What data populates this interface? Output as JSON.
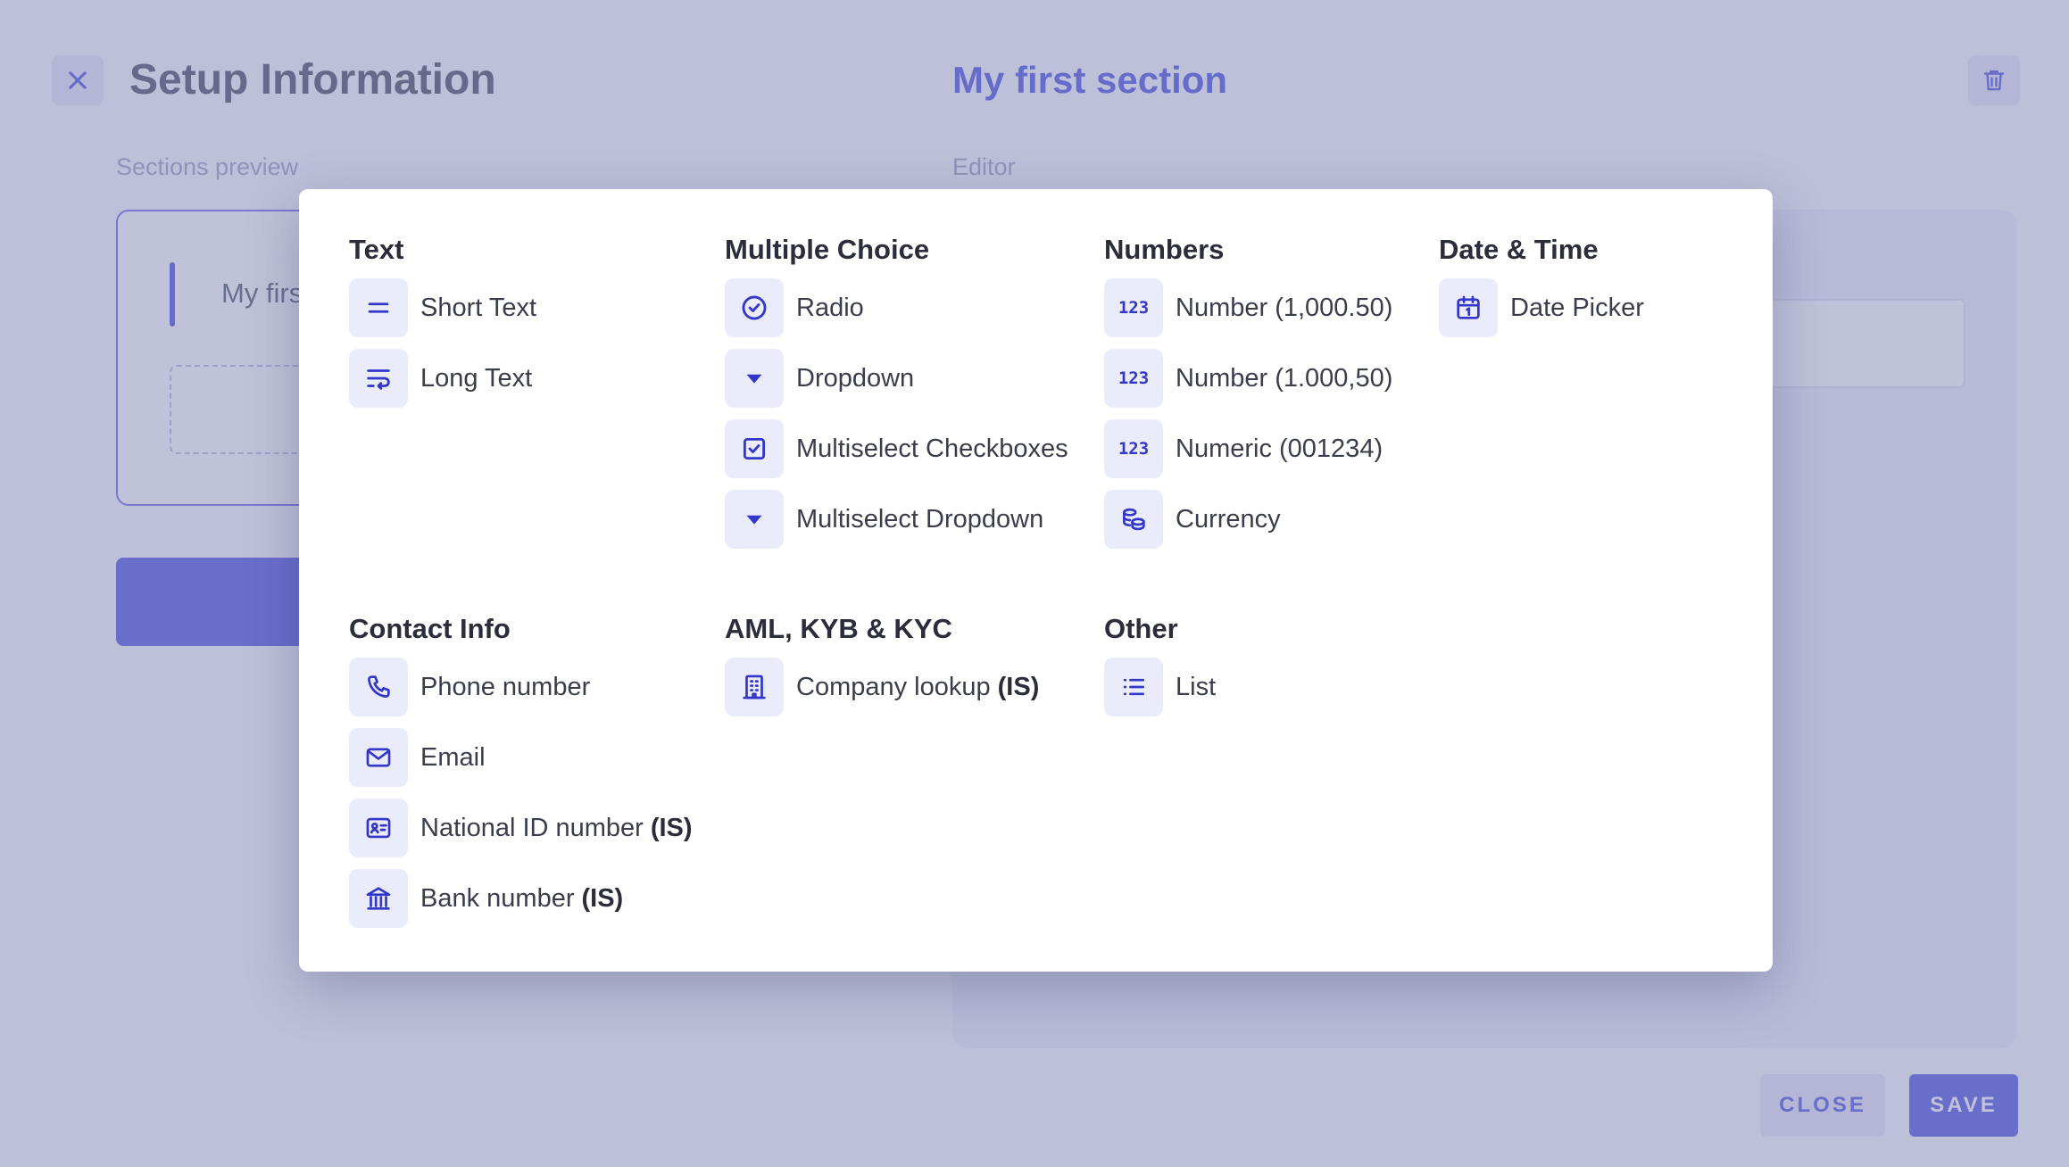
{
  "header": {
    "title": "Setup Information",
    "section_title": "My first section"
  },
  "labels": {
    "sections_preview": "Sections preview",
    "editor": "Editor"
  },
  "preview": {
    "section_name": "My firs"
  },
  "footer": {
    "close_label": "CLOSE",
    "save_label": "SAVE"
  },
  "colors": {
    "accent": "#5457e2",
    "icon_bg": "#eaecfb",
    "icon_fg": "#3336c9",
    "overlay": "#8086b4"
  },
  "picker": {
    "groups": [
      {
        "title": "Text",
        "items": [
          {
            "label": "Short Text",
            "icon": "equals-icon"
          },
          {
            "label": "Long Text",
            "icon": "text-wrap-icon"
          }
        ]
      },
      {
        "title": "Multiple Choice",
        "items": [
          {
            "label": "Radio",
            "icon": "check-circle-icon"
          },
          {
            "label": "Dropdown",
            "icon": "caret-down-icon"
          },
          {
            "label": "Multiselect Checkboxes",
            "icon": "checkbox-icon"
          },
          {
            "label": "Multiselect Dropdown",
            "icon": "caret-down-icon"
          }
        ]
      },
      {
        "title": "Numbers",
        "items": [
          {
            "label": "Number (1,000.50)",
            "icon": "numbers-icon",
            "glyph": "123"
          },
          {
            "label": "Number (1.000,50)",
            "icon": "numbers-icon",
            "glyph": "123"
          },
          {
            "label": "Numeric (001234)",
            "icon": "numbers-icon",
            "glyph": "123"
          },
          {
            "label": "Currency",
            "icon": "coins-icon"
          }
        ]
      },
      {
        "title": "Date & Time",
        "items": [
          {
            "label": "Date Picker",
            "icon": "calendar-icon"
          }
        ]
      },
      {
        "title": "Contact Info",
        "items": [
          {
            "label": "Phone number",
            "icon": "phone-icon"
          },
          {
            "label": "Email",
            "icon": "mail-icon"
          },
          {
            "label": "National ID number",
            "tag": "(IS)",
            "icon": "id-card-icon"
          },
          {
            "label": "Bank number",
            "tag": "(IS)",
            "icon": "bank-icon"
          }
        ]
      },
      {
        "title": "AML, KYB & KYC",
        "items": [
          {
            "label": "Company lookup",
            "tag": "(IS)",
            "icon": "building-icon"
          }
        ]
      },
      {
        "title": "Other",
        "items": [
          {
            "label": "List",
            "icon": "list-icon"
          }
        ]
      }
    ]
  }
}
